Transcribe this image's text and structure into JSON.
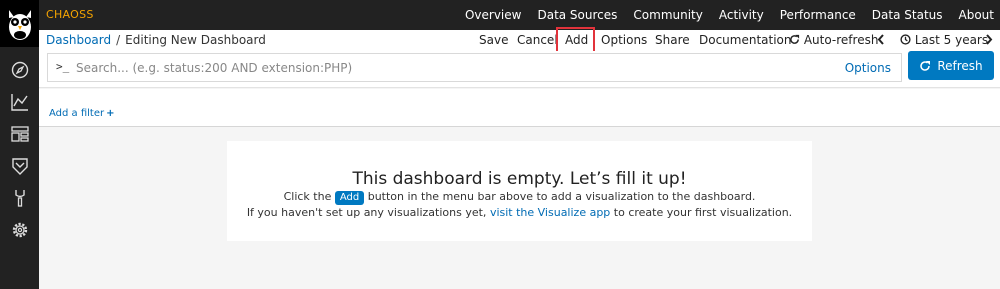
{
  "brand": "CHAOSS",
  "topnav": [
    "Overview",
    "Data Sources",
    "Community",
    "Activity",
    "Performance",
    "Data Status",
    "About"
  ],
  "breadcrumb": {
    "root": "Dashboard",
    "current": "Editing New Dashboard"
  },
  "toolbar": {
    "save": "Save",
    "cancel": "Cancel",
    "add": "Add",
    "options": "Options",
    "share": "Share",
    "documentation": "Documentation",
    "auto_refresh": "Auto-refresh",
    "time_range": "Last 5 years"
  },
  "search": {
    "placeholder": "Search... (e.g. status:200 AND extension:PHP)",
    "prompt": ">_",
    "options": "Options",
    "refresh": "Refresh"
  },
  "filter": {
    "add_label": "Add a filter",
    "plus": "+"
  },
  "empty": {
    "title": "This dashboard is empty. Let’s fill it up!",
    "line1_before": "Click the",
    "line1_button": "Add",
    "line1_after": "button in the menu bar above to add a visualization to the dashboard.",
    "line2_before": "If you haven't set up any visualizations yet,",
    "line2_link": "visit the Visualize app",
    "line2_after": "to create your first visualization."
  },
  "colors": {
    "nav_bg": "#222222",
    "brand": "#f4a300",
    "accent": "#0079c1",
    "highlight": "#e2333b"
  }
}
